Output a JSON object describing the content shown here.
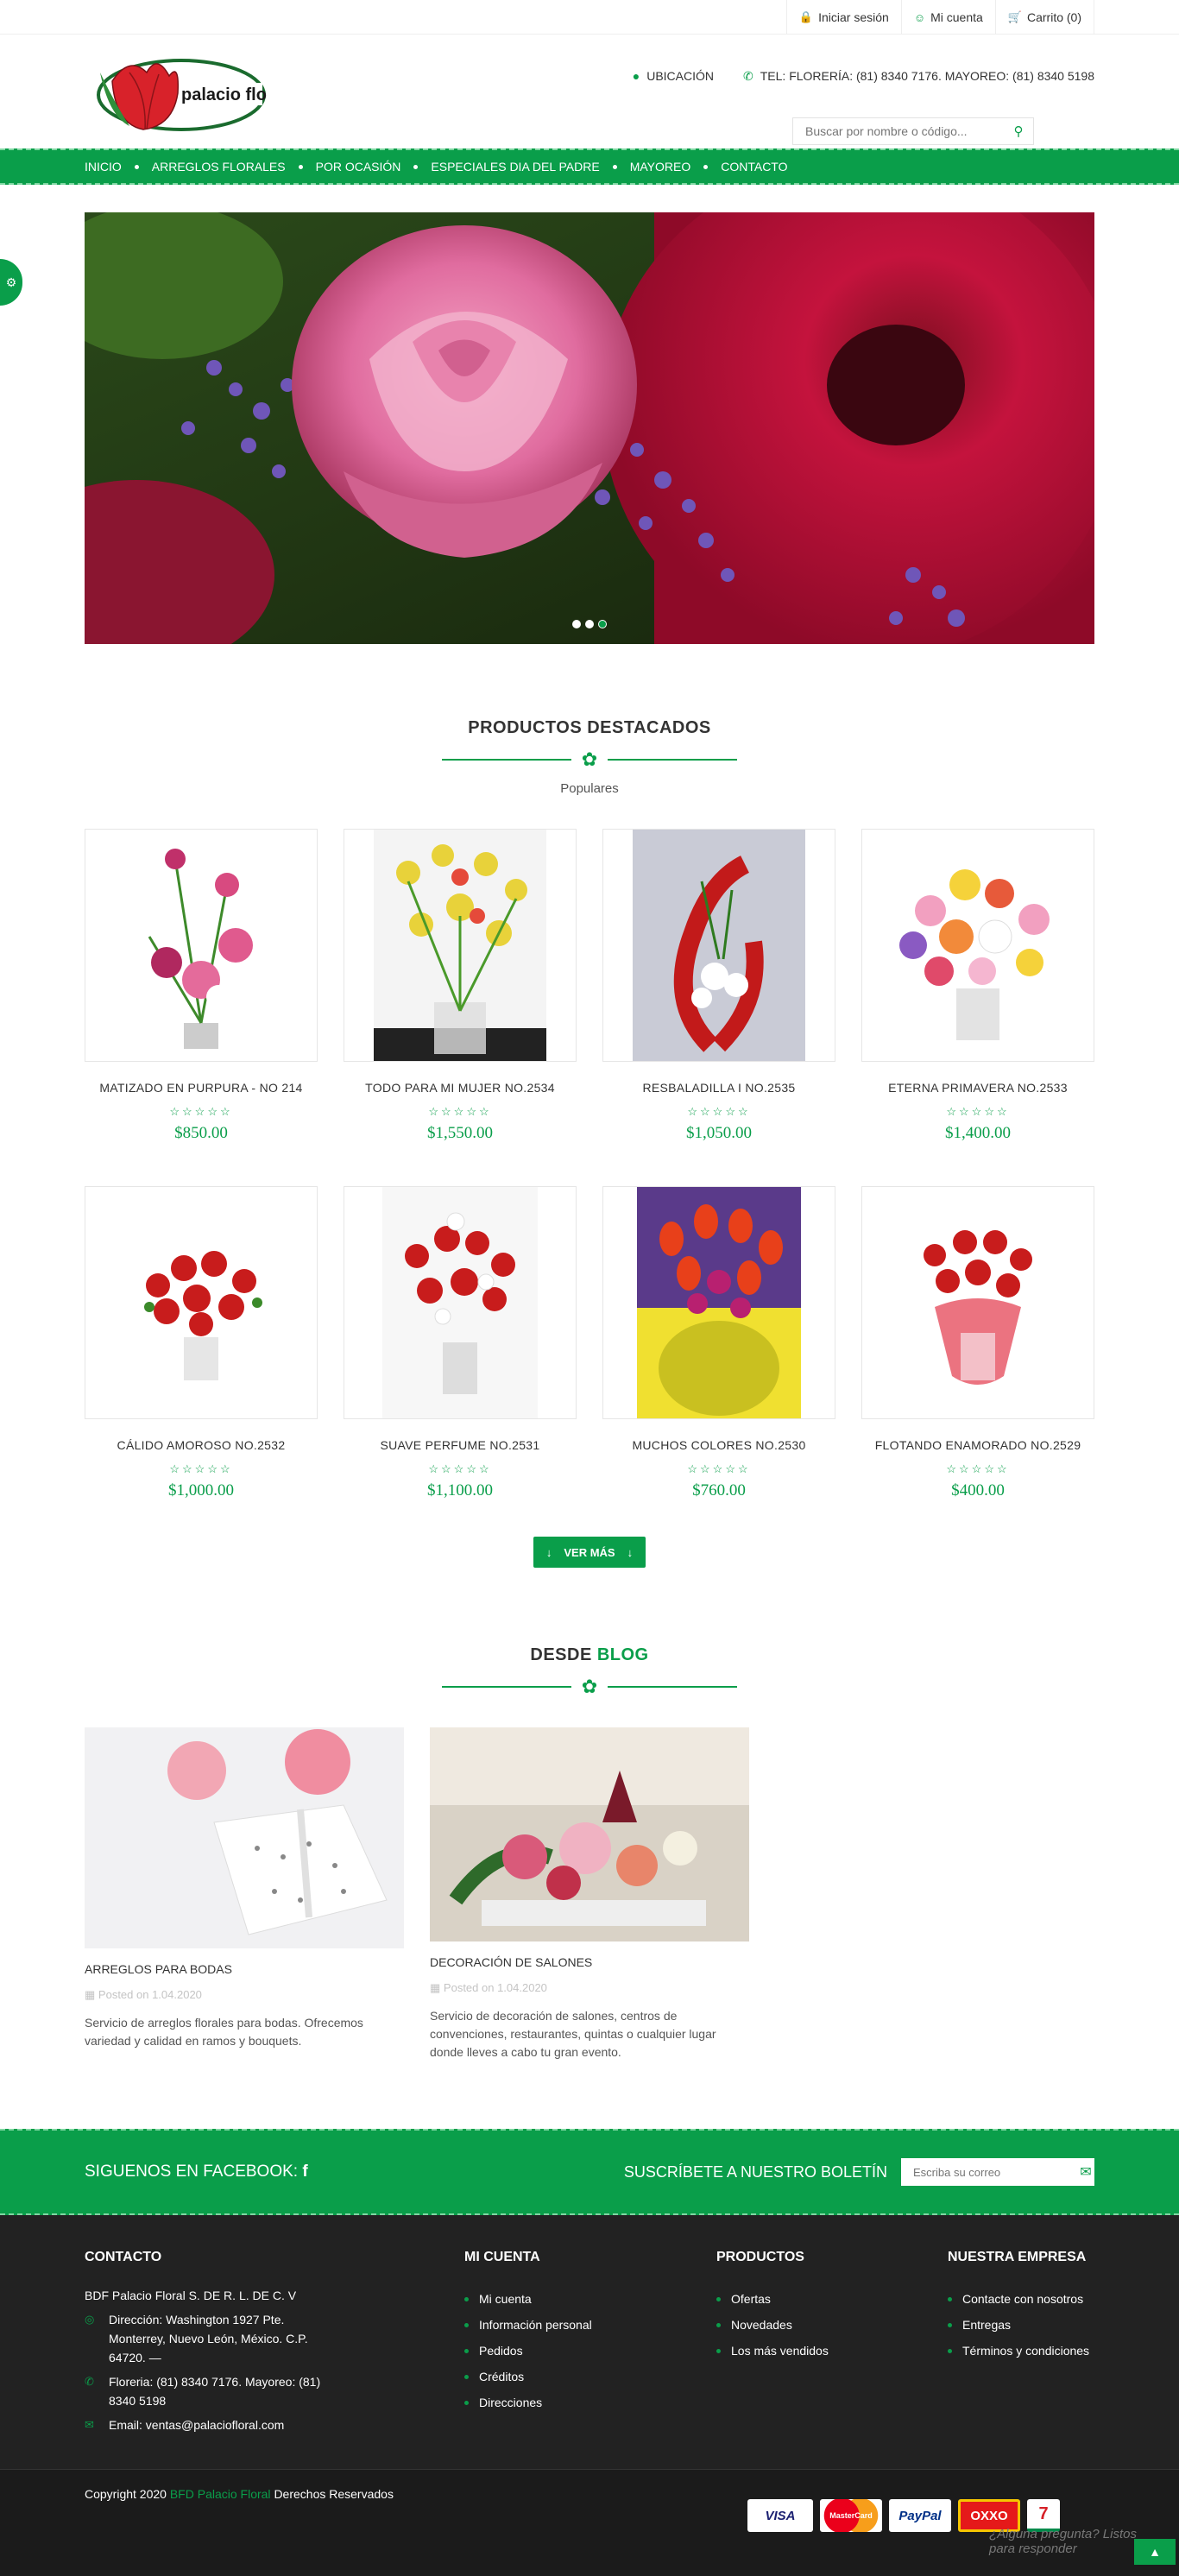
{
  "topbar": {
    "login": "Iniciar sesión",
    "account": "Mi cuenta",
    "cart": "Carrito (0)"
  },
  "header": {
    "logo_text": "palacio floral",
    "location": "UBICACIÓN",
    "phone": "TEL: FLORERÍA: (81) 8340 7176. MAYOREO: (81) 8340 5198",
    "search_placeholder": "Buscar por nombre o código..."
  },
  "nav": {
    "items": [
      "INICIO",
      "ARREGLOS FLORALES",
      "POR OCASIÓN",
      "ESPECIALES DIA DEL PADRE",
      "MAYOREO",
      "CONTACTO"
    ]
  },
  "featured": {
    "title": "PRODUCTOS DESTACADOS",
    "subtitle": "Populares",
    "more_label": "VER MÁS",
    "products": [
      {
        "name": "MATIZADO EN PURPURA - NO 214",
        "price": "$850.00"
      },
      {
        "name": "TODO PARA MI MUJER NO.2534",
        "price": "$1,550.00"
      },
      {
        "name": "RESBALADILLA I NO.2535",
        "price": "$1,050.00"
      },
      {
        "name": "ETERNA PRIMAVERA NO.2533",
        "price": "$1,400.00"
      },
      {
        "name": "CÁLIDO AMOROSO NO.2532",
        "price": "$1,000.00"
      },
      {
        "name": "SUAVE PERFUME NO.2531",
        "price": "$1,100.00"
      },
      {
        "name": "MUCHOS COLORES NO.2530",
        "price": "$760.00"
      },
      {
        "name": "FLOTANDO ENAMORADO NO.2529",
        "price": "$400.00"
      }
    ]
  },
  "blog": {
    "title_a": "DESDE",
    "title_b": "BLOG",
    "posts": [
      {
        "title": "ARREGLOS PARA BODAS",
        "date": "Posted on 1.04.2020",
        "text": "Servicio de arreglos florales para bodas. Ofrecemos variedad y calidad en ramos y bouquets."
      },
      {
        "title": "DECORACIÓN DE SALONES",
        "date": "Posted on 1.04.2020",
        "text": "Servicio de decoración de salones, centros de convenciones, restaurantes, quintas o cualquier lugar donde lleves a cabo tu gran evento."
      }
    ]
  },
  "band": {
    "facebook": "SIGUENOS EN FACEBOOK:",
    "newsletter": "SUSCRÍBETE A NUESTRO BOLETÍN",
    "email_placeholder": "Escriba su correo"
  },
  "footer": {
    "contact_title": "CONTACTO",
    "company": "BDF Palacio Floral S. DE R. L. DE C. V",
    "address": "Dirección: Washington 1927 Pte. Monterrey, Nuevo León, México. C.P. 64720. —",
    "phones": "Floreria: (81) 8340 7176. Mayoreo: (81) 8340 5198",
    "email": "Email: ventas@palaciofloral.com",
    "account_title": "MI CUENTA",
    "account_links": [
      "Mi cuenta",
      "Información personal",
      "Pedidos",
      "Créditos",
      "Direcciones"
    ],
    "products_title": "PRODUCTOS",
    "products_links": [
      "Ofertas",
      "Novedades",
      "Los más vendidos"
    ],
    "company_title": "NUESTRA EMPRESA",
    "company_links": [
      "Contacte con nosotros",
      "Entregas",
      "Términos y condiciones"
    ],
    "copyright_a": "Copyright 2020",
    "copyright_b": "BFD Palacio Floral",
    "copyright_c": "Derechos Reservados",
    "payments": [
      "VISA",
      "MasterCard",
      "PayPal",
      "OXXO",
      "7"
    ],
    "chat_text": "¿Alguna pregunta? Listos para responder"
  },
  "colors": {
    "brand_green": "#0a9e4a",
    "footer_dark": "#222222"
  },
  "icons": [
    "lock-icon",
    "user-icon",
    "cart-icon",
    "map-pin-icon",
    "phone-icon",
    "search-icon",
    "gear-icon",
    "star-icon",
    "flower-icon",
    "facebook-icon",
    "envelope-icon"
  ]
}
